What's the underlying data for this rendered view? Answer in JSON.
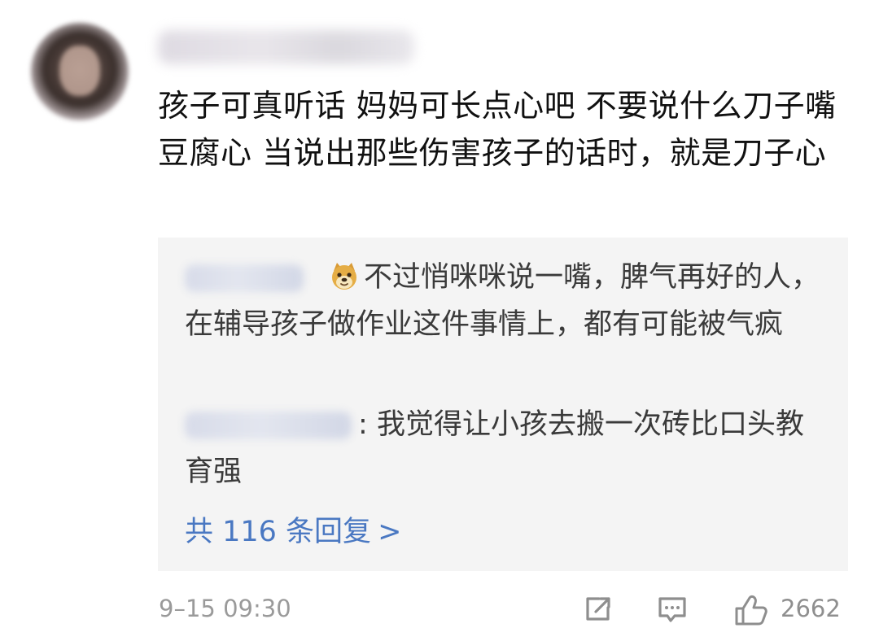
{
  "comment": {
    "text": "孩子可真听话 妈妈可长点心吧 不要说什么刀子嘴 豆腐心 当说出那些伤害孩子的话时，就是刀子心",
    "time": "9–15 09:30",
    "like_count": "2662"
  },
  "replies": [
    {
      "separator": "",
      "emoji": "doge-emoji",
      "text": "不过悄咪咪说一嘴，脾气再好的人，在辅导孩子做作业这件事情上，都有可能被气疯"
    },
    {
      "separator": ":",
      "text": "我觉得让小孩去搬一次砖比口头教育强"
    }
  ],
  "more_replies": {
    "label": "共 116 条回复",
    "arrow": ">"
  },
  "icons": {
    "share": "share-icon",
    "comment": "comment-icon",
    "like": "thumbs-up-icon"
  },
  "colors": {
    "background": "#ffffff",
    "reply_box": "#f4f4f4",
    "link": "#4a78c2",
    "secondary_text": "#9a9a9a"
  }
}
